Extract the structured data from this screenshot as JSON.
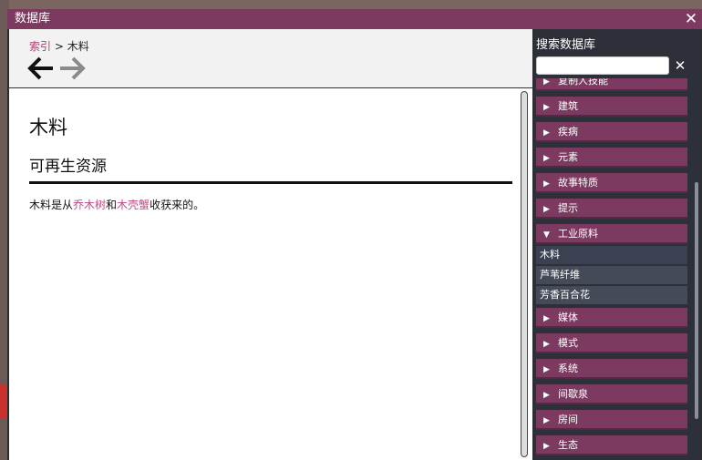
{
  "window": {
    "title": "数据库"
  },
  "breadcrumb": {
    "parent": "索引",
    "separator": " > ",
    "current": "木料"
  },
  "nav": {
    "back": "🡐",
    "forward": "🡒"
  },
  "article": {
    "title": "木料",
    "subtitle": "可再生资源",
    "text_prefix": "木料是从",
    "link1": "乔木树",
    "text_mid": "和",
    "link2": "木壳蟹",
    "text_suffix": "收获来的。"
  },
  "sidebar": {
    "search_label": "搜索数据库",
    "search_value": "",
    "categories_before": [
      "复制人技能",
      "建筑",
      "疾病",
      "元素",
      "故事特质",
      "提示"
    ],
    "expanded_category": "工业原料",
    "subitems": [
      "木料",
      "芦苇纤维",
      "芳香百合花"
    ],
    "categories_after": [
      "媒体",
      "模式",
      "系统",
      "间歇泉",
      "房间",
      "生态"
    ]
  },
  "colors": {
    "accent": "#7c3a60",
    "link": "#c04a87",
    "panel": "#2d3038"
  }
}
